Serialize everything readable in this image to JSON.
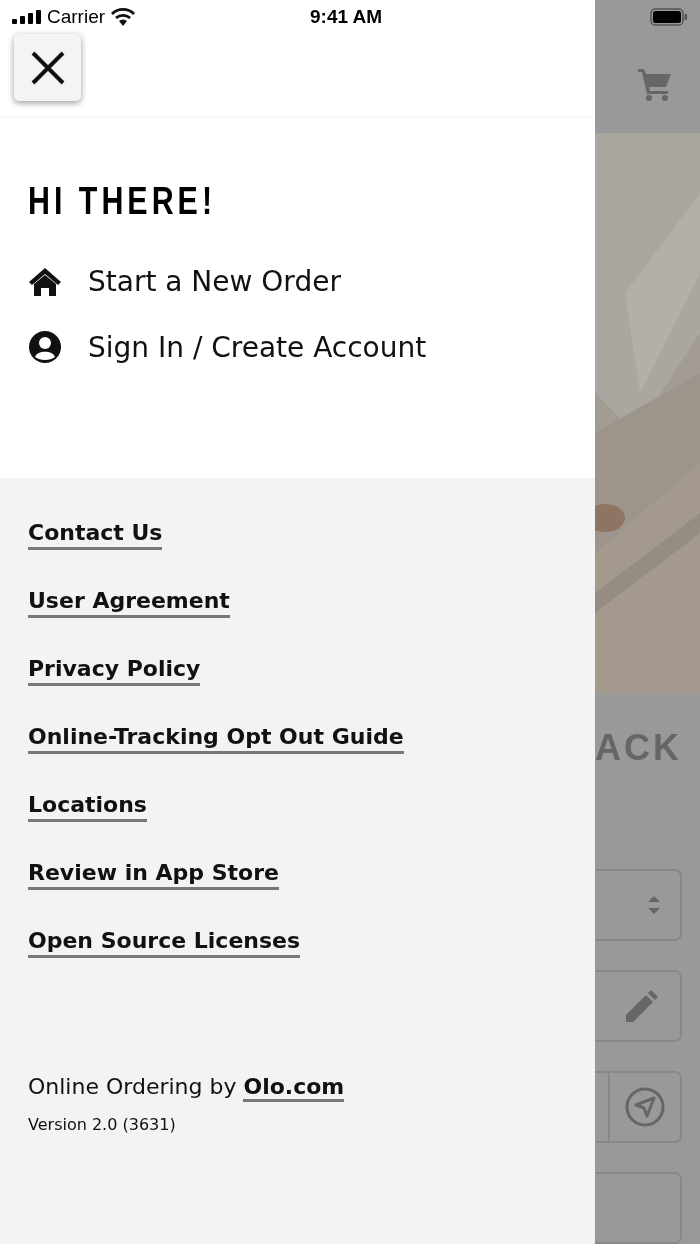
{
  "status_bar": {
    "carrier": "Carrier",
    "time": "9:41 AM"
  },
  "drawer": {
    "title": "HI THERE!",
    "menu": [
      {
        "kind": "home",
        "label": "Start a New Order"
      },
      {
        "kind": "account",
        "label": "Sign In / Create Account"
      }
    ],
    "links": [
      "Contact Us",
      "User Agreement",
      "Privacy Policy",
      "Online-Tracking Opt Out Guide",
      "Locations",
      "Review in App Store",
      "Open Source Licenses"
    ],
    "footer": {
      "credit": "Online Ordering by",
      "credit_link": "Olo.com",
      "version": "Version 2.0 (3631)"
    }
  },
  "background_page": {
    "heading": "ACK",
    "fields": [
      {
        "kind": "select"
      },
      {
        "kind": "edit"
      },
      {
        "kind": "locate"
      },
      {
        "kind": "blank"
      }
    ]
  }
}
